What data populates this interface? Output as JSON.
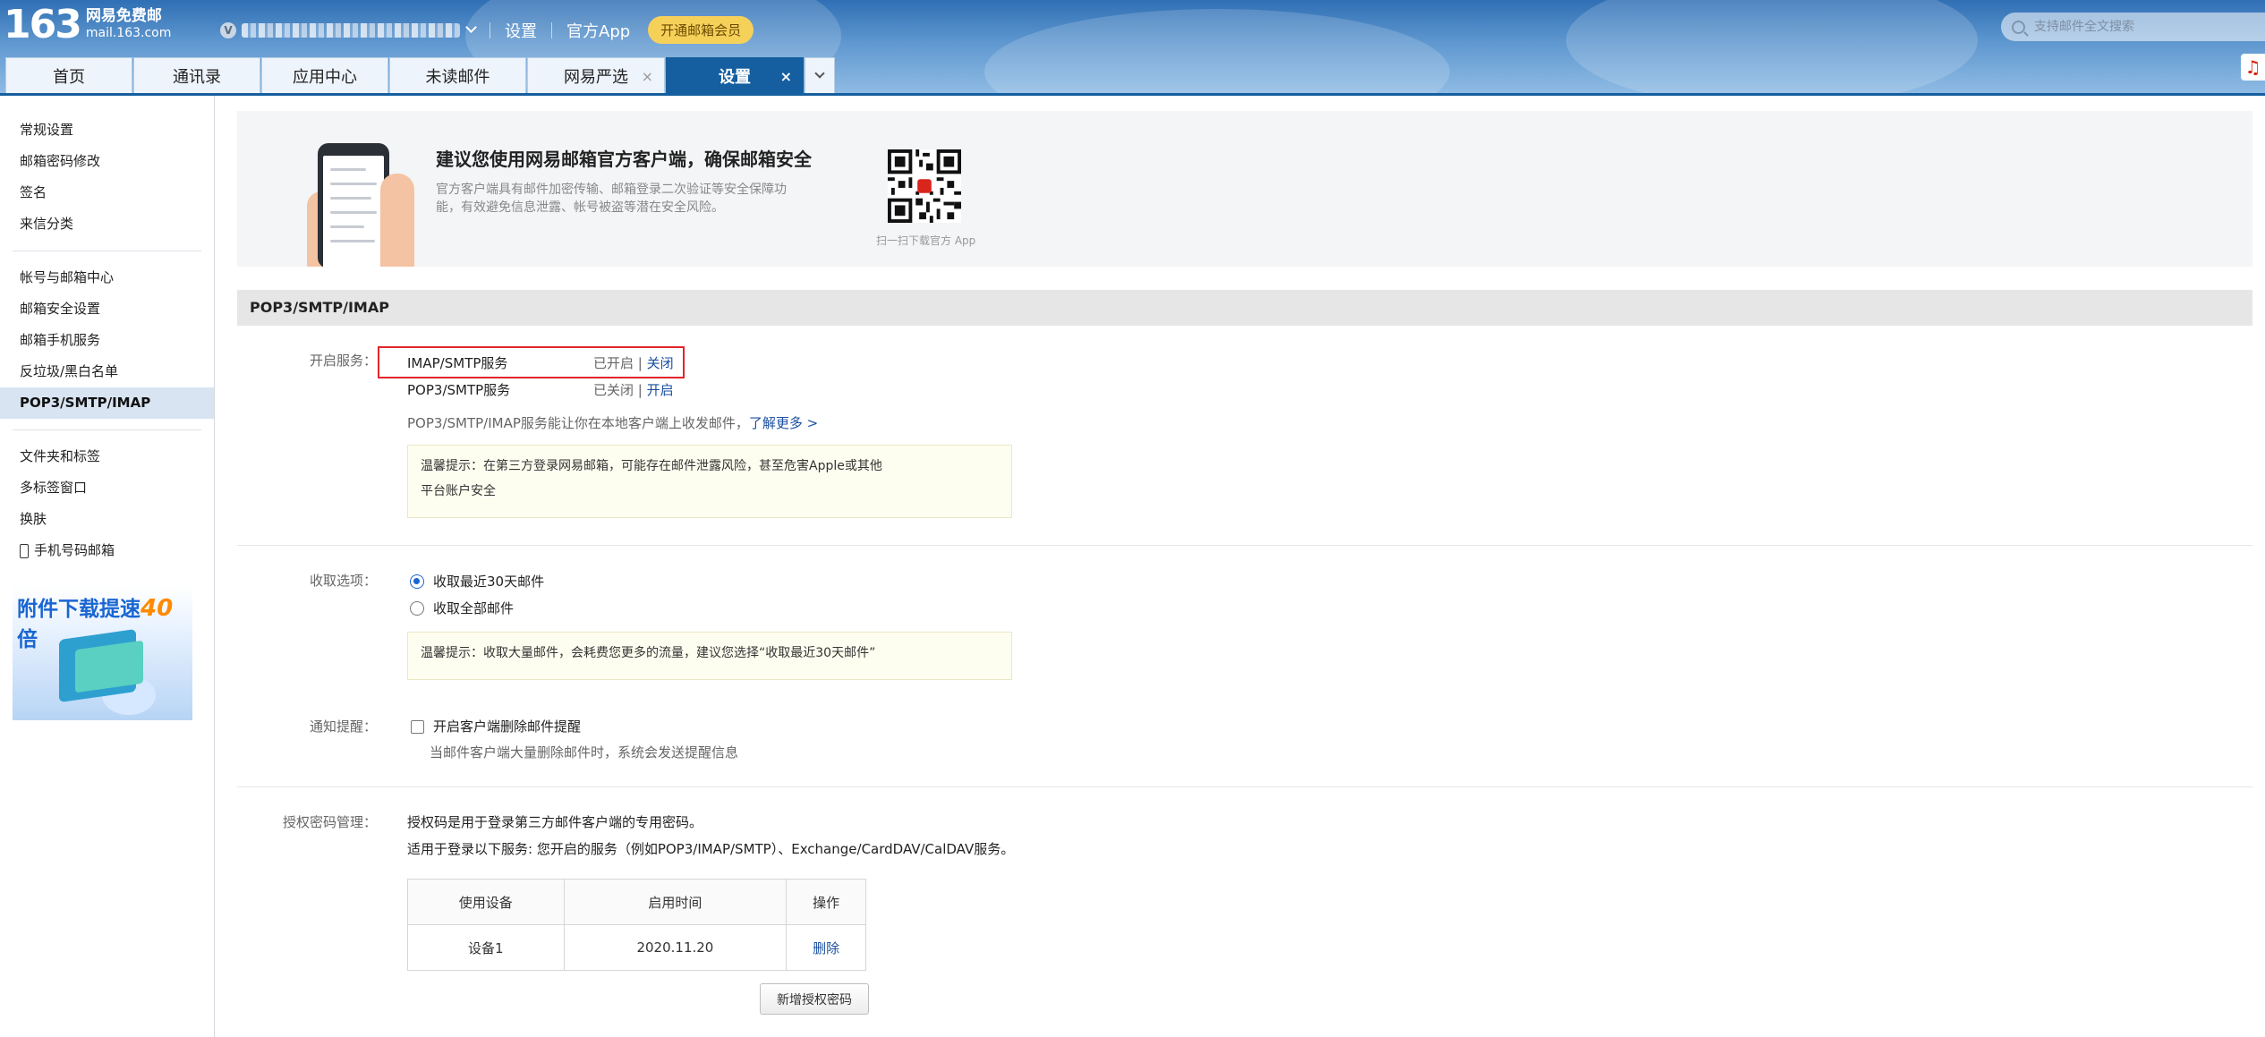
{
  "header": {
    "logo_number": "163",
    "logo_title": "网易免费邮",
    "logo_domain": "mail.163.com",
    "vip_letter": "V",
    "links": [
      "设置",
      "官方App"
    ],
    "vip_button": "开通邮箱会员",
    "search_placeholder": "支持邮件全文搜索"
  },
  "tabs": [
    {
      "label": "首页"
    },
    {
      "label": "通讯录"
    },
    {
      "label": "应用中心"
    },
    {
      "label": "未读邮件"
    },
    {
      "label": "网易严选",
      "close": "×"
    },
    {
      "label": "设置",
      "close": "×"
    }
  ],
  "sidebar": {
    "group1": [
      "常规设置",
      "邮箱密码修改",
      "签名",
      "来信分类"
    ],
    "group2": [
      "帐号与邮箱中心",
      "邮箱安全设置",
      "邮箱手机服务",
      "反垃圾/黑白名单",
      "POP3/SMTP/IMAP"
    ],
    "group3": [
      "文件夹和标签",
      "多标签窗口",
      "换肤",
      "手机号码邮箱"
    ],
    "ad_text": "附件下载提速",
    "ad_speed": "40",
    "ad_suffix": "倍"
  },
  "banner": {
    "title": "建议您使用网易邮箱官方客户端，确保邮箱安全",
    "desc": "官方客户端具有邮件加密传输、邮箱登录二次验证等安全保障功能，有效避免信息泄露、帐号被盗等潜在安全风险。",
    "qr_caption": "扫一扫下载官方 App"
  },
  "section": {
    "title": "POP3/SMTP/IMAP"
  },
  "services": {
    "label": "开启服务：",
    "items": [
      {
        "name": "IMAP/SMTP服务",
        "status": "已开启",
        "sep": "|",
        "action": "关闭"
      },
      {
        "name": "POP3/SMTP服务",
        "status": "已关闭",
        "sep": "|",
        "action": "开启"
      }
    ],
    "desc": "POP3/SMTP/IMAP服务能让你在本地客户端上收发邮件，",
    "learn_more": "了解更多 >",
    "tip_line1": "温馨提示：在第三方登录网易邮箱，可能存在邮件泄露风险，甚至危害Apple或其他",
    "tip_line2": "平台账户安全"
  },
  "receive": {
    "label": "收取选项：",
    "option1": "收取最近30天邮件",
    "option2": "收取全部邮件",
    "tip": "温馨提示：收取大量邮件，会耗费您更多的流量，建议您选择“收取最近30天邮件”"
  },
  "notify": {
    "label": "通知提醒：",
    "checkbox_label": "开启客户端删除邮件提醒",
    "desc": "当邮件客户端大量删除邮件时，系统会发送提醒信息"
  },
  "auth": {
    "label": "授权密码管理：",
    "line1": "授权码是用于登录第三方邮件客户端的专用密码。",
    "line2": "适用于登录以下服务: 您开启的服务（例如POP3/IMAP/SMTP）、Exchange/CardDAV/CalDAV服务。",
    "table_headers": [
      "使用设备",
      "启用时间",
      "操作"
    ],
    "rows": [
      {
        "device": "设备1",
        "time": "2020.11.20",
        "action": "删除"
      }
    ],
    "add_button": "新增授权密码"
  }
}
